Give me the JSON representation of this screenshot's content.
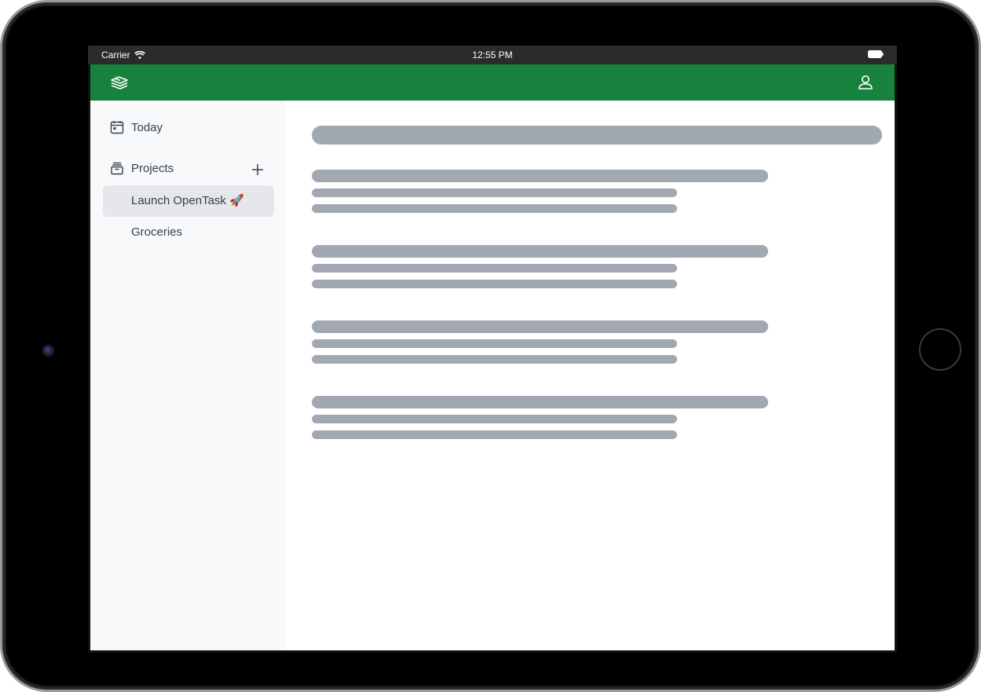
{
  "status_bar": {
    "carrier": "Carrier",
    "time": "12:55 PM"
  },
  "header": {
    "background": "#17823d",
    "logo_icon": "layers-icon",
    "profile_icon": "user-icon"
  },
  "sidebar": {
    "today_label": "Today",
    "projects_label": "Projects",
    "add_icon": "plus-icon",
    "projects": [
      {
        "label": "Launch OpenTask 🚀",
        "active": true
      },
      {
        "label": "Groceries",
        "active": false
      }
    ]
  },
  "main": {
    "state": "loading",
    "skeleton_groups": 4
  }
}
